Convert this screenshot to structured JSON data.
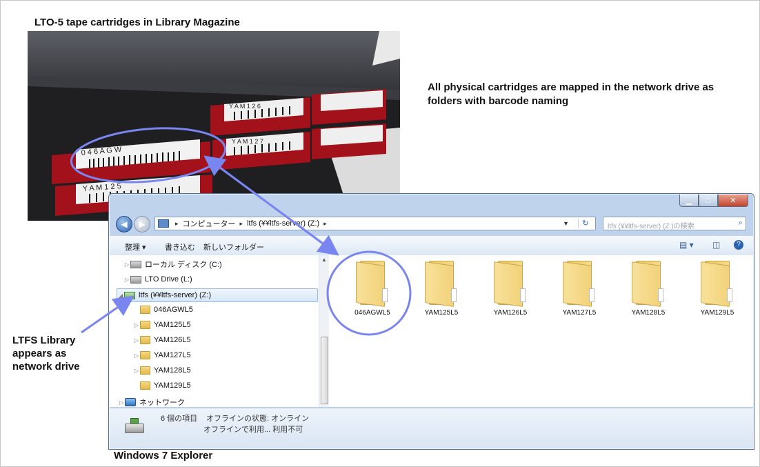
{
  "captions": {
    "photo_title": "LTO-5 tape cartridges in Library Magazine",
    "description": "All physical cartridges are mapped in the network drive as folders with barcode naming",
    "ltfs_note": "LTFS Library appears as network drive",
    "explorer_label": "Windows 7 Explorer"
  },
  "photo": {
    "labels": [
      "0 4 6 A G W",
      "Y A M 1 2 5",
      "Y A M 1 2 6",
      "Y A M 1 2 7"
    ]
  },
  "explorer": {
    "address": {
      "crumbs": [
        "コンピューター",
        "ltfs (¥¥ltfs-server) (Z:)"
      ],
      "separator": "▸"
    },
    "search_placeholder": "ltfs (¥¥ltfs-server) (Z:)の検索",
    "toolbar": {
      "organize": "整理 ▾",
      "burn": "書き込む",
      "new_folder": "新しいフォルダー"
    },
    "nav": {
      "local_disk": "ローカル ディスク (C:)",
      "lto_drive": "LTO Drive (L:)",
      "ltfs_drive": "ltfs (¥¥ltfs-server) (Z:)",
      "folders": [
        "046AGWL5",
        "YAM125L5",
        "YAM126L5",
        "YAM127L5",
        "YAM128L5",
        "YAM129L5"
      ],
      "network": "ネットワーク"
    },
    "files": [
      "046AGWL5",
      "YAM125L5",
      "YAM126L5",
      "YAM127L5",
      "YAM128L5",
      "YAM129L5"
    ],
    "status": {
      "count": "6 個の項目",
      "offline_state": "オフラインの状態:  オンライン",
      "offline_use": "オフラインで利用...  利用不可"
    }
  },
  "colors": {
    "annotation": "#7a86f0",
    "cartridge": "#b3121b"
  }
}
